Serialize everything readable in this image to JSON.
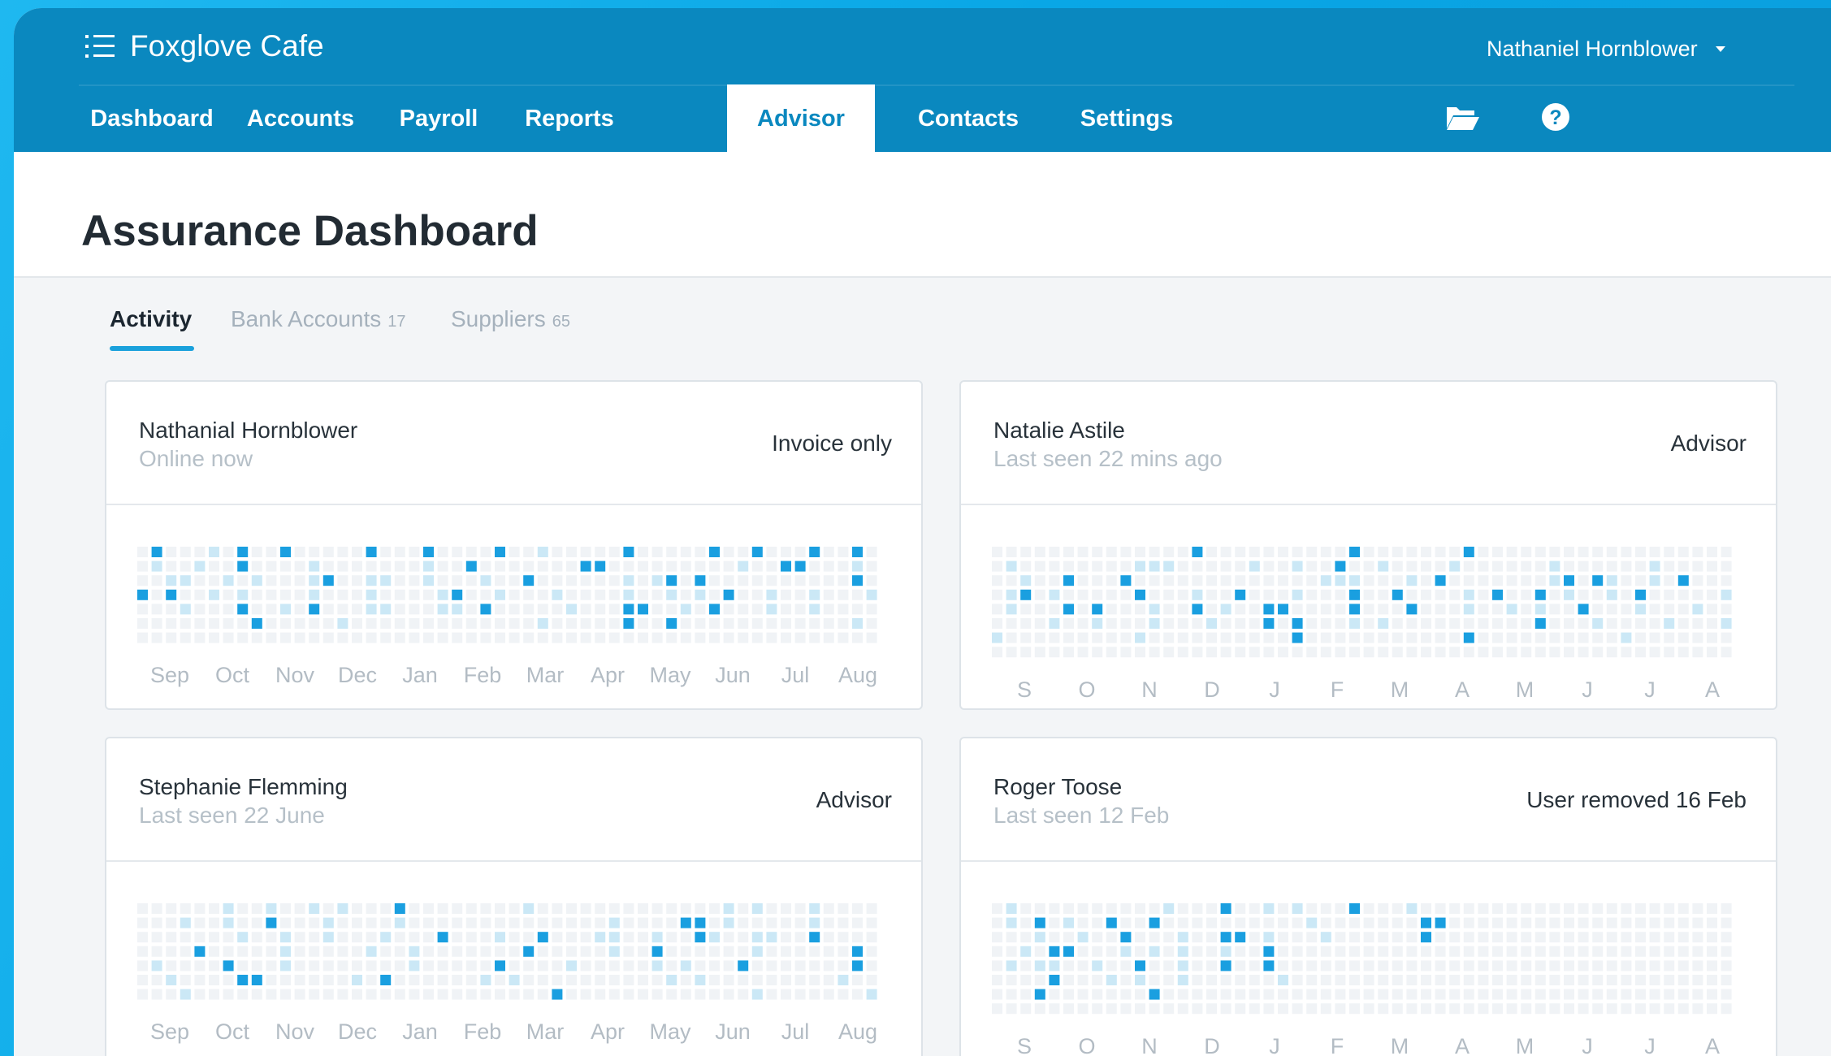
{
  "app": {
    "title": "Foxglove Cafe",
    "menu_icon": "menu-list-icon"
  },
  "user": {
    "name": "Nathaniel Hornblower",
    "caret_icon": "caret-down-icon"
  },
  "nav": {
    "tabs": [
      {
        "label": "Dashboard",
        "active": false
      },
      {
        "label": "Accounts",
        "active": false
      },
      {
        "label": "Payroll",
        "active": false
      },
      {
        "label": "Reports",
        "active": false
      },
      {
        "label": "Advisor",
        "active": true
      },
      {
        "label": "Contacts",
        "active": false
      },
      {
        "label": "Settings",
        "active": false
      }
    ],
    "icons": [
      "folder-open-icon",
      "help-icon"
    ]
  },
  "page": {
    "title": "Assurance Dashboard"
  },
  "subtabs": [
    {
      "label": "Activity",
      "count": "",
      "active": true
    },
    {
      "label": "Bank Accounts",
      "count": "17",
      "active": false
    },
    {
      "label": "Suppliers",
      "count": "65",
      "active": false
    }
  ],
  "colors": {
    "brand": "#0a88bf",
    "accent": "#1aa1dc",
    "background": "#0ba6e4",
    "cell_empty": "#f0f3f6",
    "cell_light": "#cbe8f6",
    "cell_medium": "#8fd0f0",
    "cell_dark": "#1a9fe0"
  },
  "cards": [
    {
      "name": "Nathanial Hornblower",
      "status": "Online now",
      "role": "Invoice only",
      "months": [
        "Sep",
        "Oct",
        "Nov",
        "Dec",
        "Jan",
        "Feb",
        "Mar",
        "Apr",
        "May",
        "Jun",
        "Jul",
        "Aug"
      ],
      "grid": [
        ".#...:.#..#.....#...#....#..:.....#.....#..#...#..#..#..:...........",
        ".:..:..#....:.......:..#.......##.........:..##...:.#...:..#........",
        "..::..:.:...:#..::..:...:..#......:.:#.#..........#...#..:..:..#.#..",
        "#.#..:.:....:...:....:#..:...:....:..:.:.#..:..:...:......:..:..:...",
        "...:...#..:.#...::...::.#.....:...##..:.#...:..:....#.....:..:..:...",
        "........#.....:.............:.....#..#............:..........#......",
        "...................................................................."
      ]
    },
    {
      "name": "Natalie Astile",
      "status": "Last seen 22 mins ago",
      "role": "Advisor",
      "months": [
        "S",
        "O",
        "N",
        "D",
        "J",
        "F",
        "M",
        "A",
        "M",
        "J",
        "J",
        "A"
      ],
      "grid": [
        "..............#..........#.......#..................................",
        ".:........:::.....:..:..#..:....:......:......:.....::..::..:.#::...",
        "..:..#...#.............:::...:.#.......:#.#:..:.#...#.:..::.::..#...",
        ".:#.:.....#...:..#...:...#..#....:.#..#.:..:.#.....:.......:.:...#..",
        ".:...#.#...:..#.:..##....#...#...:..:.:..#...:...:......#..:...##...",
        "....:..:...:...:...#.#...:.:..........#...:....:...:..:....:........",
        ":.........:..........#...........#..........:.......................",
        "...................................................................."
      ]
    },
    {
      "name": "Stephanie Flemming",
      "status": "Last seen 22 June",
      "role": "Advisor",
      "months": [
        "Sep",
        "Oct",
        "Nov",
        "Dec",
        "Jan",
        "Feb",
        "Mar",
        "Apr",
        "May",
        "Jun",
        "Jul",
        "Aug"
      ],
      "grid": [
        "......:..:..:.:...#........:.............:.:...:..........#.......:.",
        "...:..:..#...:....:..............:....##.:.....:....:.......##..:...",
        ".......:..:..:...:...#...:..#...::..:..#:..::..#........:.......:...",
        "....#.....:.....:..:.......#.....:..#......:......#.#....:..#...#...",
        ".:....#...:........:.....#....:.....:.:...#.......#.....#....#......",
        "..:....##......:.#......:.:..........:.:.........:......:...#.......",
        "...:.........................#.............:.......:...............:"
      ]
    },
    {
      "name": "Roger Toose",
      "status": "Last seen 12 Feb",
      "role": "User removed 16 Feb",
      "months": [
        "S",
        "O",
        "N",
        "D",
        "J",
        "F",
        "M",
        "A",
        "M",
        "J",
        "J",
        "A"
      ],
      "grid": [
        ".:..........:...#..:.:...#...:..............................",
        ".:.#.:..#..#..........:.......##............................",
        "...:..:..#...:..##.:...:......#.............................",
        "..:.##...:.:.:..:..#.......................................",
        ".:.::..:..#..:..#..#............................................",
        "....#...:.:..:......:.......................................",
        "...#.......#.......................................................",
        "...................................................................."
      ]
    }
  ]
}
